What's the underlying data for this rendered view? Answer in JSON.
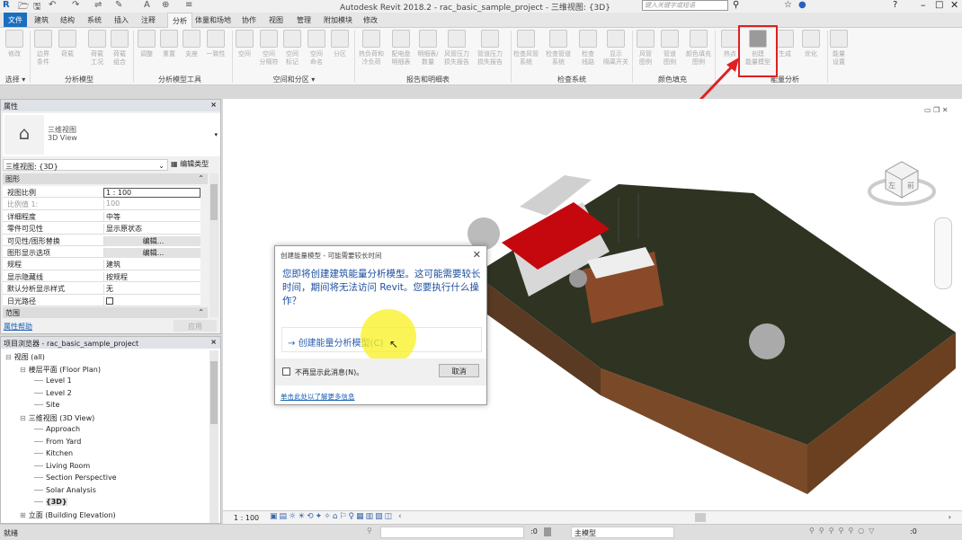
{
  "app": {
    "title": "Autodesk Revit 2018.2 -    rac_basic_sample_project - 三维视图: {3D}",
    "search_placeholder": "键入关键字或短语"
  },
  "qat": [
    "R",
    "🗁",
    "🖫",
    "↶",
    "↷",
    "⇌",
    "✎",
    "A",
    "⊕",
    "≡"
  ],
  "tabs": [
    "文件",
    "建筑",
    "结构",
    "系统",
    "插入",
    "注释",
    "分析",
    "体量和场地",
    "协作",
    "视图",
    "管理",
    "附加模块",
    "修改"
  ],
  "active_tab": "分析",
  "ribbon": {
    "buttons": [
      [
        "修改"
      ],
      [
        "边界",
        "条件"
      ],
      [
        "荷载"
      ],
      [
        "荷载",
        "工况"
      ],
      [
        "荷载",
        "组合"
      ],
      [
        "调整"
      ],
      [
        "重置"
      ],
      [
        "支座"
      ],
      [
        "一致性"
      ],
      [
        "空间"
      ],
      [
        "空间",
        "分隔符"
      ],
      [
        "空间",
        "标记"
      ],
      [
        "空间",
        "命名"
      ],
      [
        "分区"
      ],
      [
        "热负荷和",
        "冷负荷"
      ],
      [
        "配电盘",
        "明细表"
      ],
      [
        "明细表/",
        "数量"
      ],
      [
        "风管压力",
        "损失报告"
      ],
      [
        "管道压力",
        "损失报告"
      ],
      [
        "检查风管",
        "系统"
      ],
      [
        "检查管道",
        "系统"
      ],
      [
        "检查",
        "线路"
      ],
      [
        "显示",
        "隔离开关"
      ],
      [
        "风管",
        "图例"
      ],
      [
        "管道",
        "图例"
      ],
      [
        "颜色填充",
        "图例"
      ],
      [
        "热点"
      ],
      [
        "创建",
        "能量模型"
      ],
      [
        "生成"
      ],
      [
        "优化"
      ],
      [
        "能量",
        "设置"
      ]
    ],
    "groups": [
      "选择 ▾",
      "分析模型",
      "分析模型工具",
      "空间和分区 ▾",
      "报告和明细表",
      "检查系统",
      "颜色填充",
      "能量分析"
    ],
    "highlighted_button": "创建能量模型",
    "highlight_color": "#e02020"
  },
  "properties": {
    "title": "属性",
    "type_cn": "三维视图",
    "type_en": "3D View",
    "selector": "三维视图: {3D}",
    "edit_type": "编辑类型",
    "section_graphics": "图形",
    "section_range": "范围",
    "rows": [
      [
        "视图比例",
        "1 : 100"
      ],
      [
        "比例值 1:",
        "100"
      ],
      [
        "详细程度",
        "中等"
      ],
      [
        "零件可见性",
        "显示原状态"
      ],
      [
        "可见性/图形替换",
        "编辑..."
      ],
      [
        "图形显示选项",
        "编辑..."
      ],
      [
        "规程",
        "建筑"
      ],
      [
        "显示隐藏线",
        "按规程"
      ],
      [
        "默认分析显示样式",
        "无"
      ],
      [
        "日光路径",
        ""
      ]
    ],
    "help": "属性帮助",
    "apply": "应用"
  },
  "browser": {
    "title": "项目浏览器 - rac_basic_sample_project",
    "items": [
      [
        "⊟",
        "视图 (all)",
        0
      ],
      [
        "⊟",
        "楼层平面 (Floor Plan)",
        1
      ],
      [
        "",
        "Level 1",
        2
      ],
      [
        "",
        "Level 2",
        2
      ],
      [
        "",
        "Site",
        2
      ],
      [
        "⊟",
        "三维视图 (3D View)",
        1
      ],
      [
        "",
        "Approach",
        2
      ],
      [
        "",
        "From Yard",
        2
      ],
      [
        "",
        "Kitchen",
        2
      ],
      [
        "",
        "Living Room",
        2
      ],
      [
        "",
        "Section Perspective",
        2
      ],
      [
        "",
        "Solar Analysis",
        2
      ],
      [
        "",
        "{3D}",
        2
      ],
      [
        "⊞",
        "立面 (Building Elevation)",
        1
      ]
    ]
  },
  "dialog": {
    "title": "创建能量模型 - 可能需要较长时间",
    "message": "您即将创建建筑能量分析模型。这可能需要较长时间，期间将无法访问 Revit。您要执行什么操作？",
    "command": "创建能量分析模型(C)",
    "dont_show": "不再显示此消息(N)。",
    "cancel": "取消",
    "more": "单击此处以了解更多信息"
  },
  "viewbar": {
    "scale": "1 : 100"
  },
  "status": {
    "ready": "就绪",
    "count1": ":0",
    "model": "主模型",
    "filter": ":0"
  },
  "viewcube": {
    "front": "前",
    "left": "左"
  }
}
